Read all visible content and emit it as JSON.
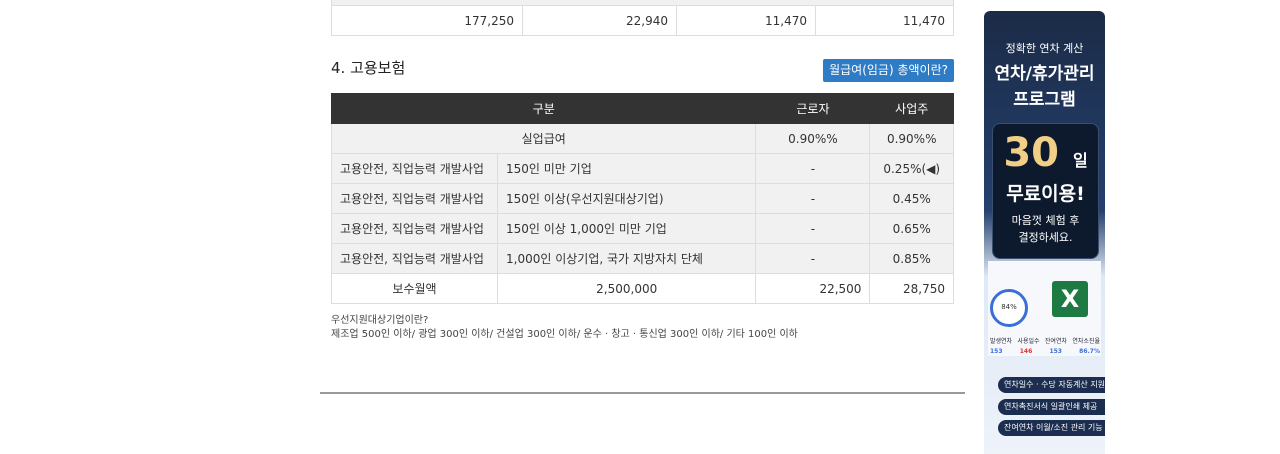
{
  "top_row": {
    "c1": "177,250",
    "c2": "22,940",
    "c3": "11,470",
    "c4": "11,470"
  },
  "section": {
    "title": "4. 고용보험",
    "help_button": "월급여(임금) 총액이란?"
  },
  "table": {
    "headers": [
      "구분",
      "근로자",
      "사업주"
    ],
    "rows": [
      {
        "category": "실업급여",
        "worker": "0.90%%",
        "employer": "0.90%%"
      },
      {
        "category": "고용안전, 직업능력 개발사업",
        "sub": "150인 미만 기업",
        "worker": "-",
        "employer": "0.25%(◀)"
      },
      {
        "category": "고용안전, 직업능력 개발사업",
        "sub": "150인 이상(우선지원대상기업)",
        "worker": "-",
        "employer": "0.45%"
      },
      {
        "category": "고용안전, 직업능력 개발사업",
        "sub": "150인 이상 1,000인 미만 기업",
        "worker": "-",
        "employer": "0.65%"
      },
      {
        "category": "고용안전, 직업능력 개발사업",
        "sub": "1,000인 이상기업, 국가 지방자치 단체",
        "worker": "-",
        "employer": "0.85%"
      }
    ],
    "total": {
      "label": "보수월액",
      "amount": "2,500,000",
      "worker": "22,500",
      "employer": "28,750"
    }
  },
  "note": {
    "line1": "우선지원대상기업이란?",
    "line2": "제조업 500인 이하/ 광업 300인 이하/ 건설업 300인 이하/ 운수 · 창고 · 통신업 300인 이하/ 기타 100인 이하"
  },
  "ad": {
    "line1": "정확한 연차 계산",
    "line2": "연차/휴가관리",
    "line3": "프로그램",
    "days": "30",
    "days_unit": "일",
    "free": "무료이용!",
    "desc1": "마음껏 체험 후",
    "desc2": "결정하세요.",
    "percent": "84%",
    "excel": "X",
    "stats_labels": [
      "발생연차",
      "사용일수",
      "잔여연차",
      "연차소진율"
    ],
    "stats_values": [
      "153",
      "146",
      "153",
      "86.7%"
    ],
    "features": [
      "연차일수 · 수당 자동계산 지원",
      "연차촉진서식 일괄인쇄 제공",
      "잔여연차 이월/소진 관리 기능"
    ]
  }
}
